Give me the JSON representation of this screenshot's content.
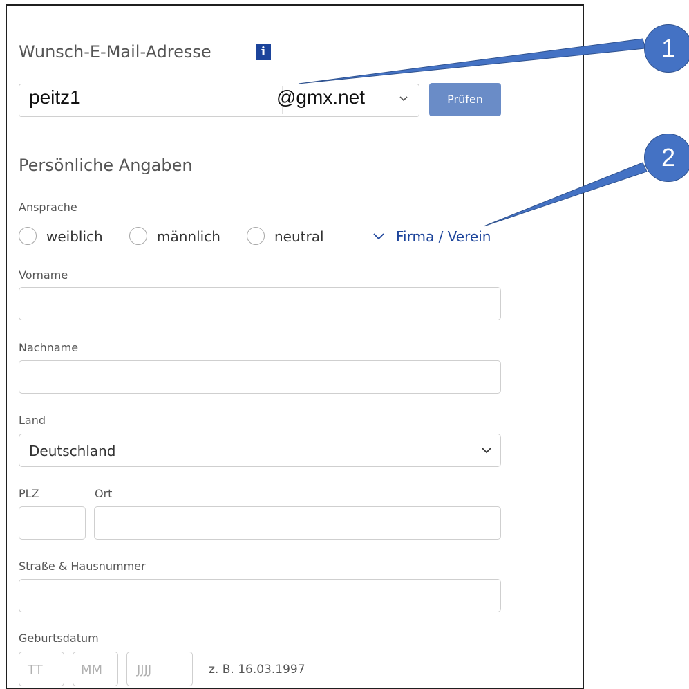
{
  "email": {
    "heading": "Wunsch-E-Mail-Adresse",
    "info_icon": "i",
    "local_part": "peitz1",
    "domain": "@gmx.net",
    "check_button": "Prüfen"
  },
  "personal": {
    "heading": "Persönliche Angaben",
    "salutation_label": "Ansprache",
    "salutations": [
      "weiblich",
      "männlich",
      "neutral"
    ],
    "company_link": "Firma / Verein",
    "firstname_label": "Vorname",
    "lastname_label": "Nachname",
    "country_label": "Land",
    "country_value": "Deutschland",
    "zip_label": "PLZ",
    "city_label": "Ort",
    "street_label": "Straße & Hausnummer",
    "birthdate_label": "Geburtsdatum",
    "birthdate_placeholders": [
      "TT",
      "MM",
      "JJJJ"
    ],
    "birthdate_hint": "z. B. 16.03.1997"
  },
  "annotations": {
    "badge1": "1",
    "badge2": "2",
    "color": "#4472c4"
  }
}
